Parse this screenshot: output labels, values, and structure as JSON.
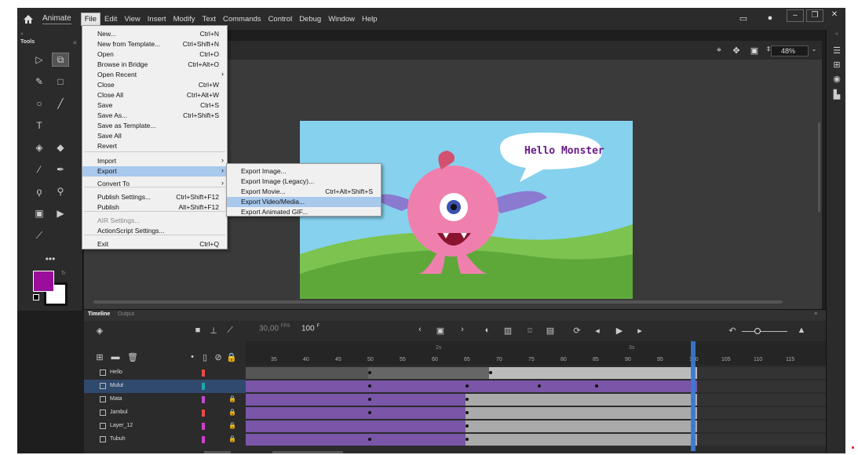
{
  "app": {
    "name": "Animate"
  },
  "menubar": [
    "File",
    "Edit",
    "View",
    "Insert",
    "Modify",
    "Text",
    "Commands",
    "Control",
    "Debug",
    "Window",
    "Help"
  ],
  "tools": {
    "title": "Tools"
  },
  "colors": {
    "fill": "#9b0d9b",
    "stroke": "#ffffff",
    "accent": "#3a7bd5",
    "selected_layer": "#304a6e"
  },
  "file_menu": [
    {
      "label": "New...",
      "shortcut": "Ctrl+N"
    },
    {
      "label": "New from Template...",
      "shortcut": "Ctrl+Shift+N"
    },
    {
      "label": "Open",
      "shortcut": "Ctrl+O"
    },
    {
      "label": "Browse in Bridge",
      "shortcut": "Ctrl+Alt+O"
    },
    {
      "label": "Open Recent",
      "shortcut": "",
      "submenu": true
    },
    {
      "label": "Close",
      "shortcut": "Ctrl+W"
    },
    {
      "label": "Close All",
      "shortcut": "Ctrl+Alt+W"
    },
    {
      "label": "Save",
      "shortcut": "Ctrl+S"
    },
    {
      "label": "Save As...",
      "shortcut": "Ctrl+Shift+S"
    },
    {
      "label": "Save as Template...",
      "shortcut": ""
    },
    {
      "label": "Save All",
      "shortcut": ""
    },
    {
      "label": "Revert",
      "shortcut": ""
    },
    {
      "label": "Import",
      "shortcut": "",
      "submenu": true
    },
    {
      "label": "Export",
      "shortcut": "",
      "submenu": true,
      "highlight": true
    },
    {
      "label": "Convert To",
      "shortcut": "",
      "submenu": true
    },
    {
      "label": "Publish Settings...",
      "shortcut": "Ctrl+Shift+F12"
    },
    {
      "label": "Publish",
      "shortcut": "Alt+Shift+F12"
    },
    {
      "label": "AIR Settings...",
      "shortcut": "",
      "disabled": true
    },
    {
      "label": "ActionScript Settings...",
      "shortcut": ""
    },
    {
      "label": "Exit",
      "shortcut": "Ctrl+Q"
    }
  ],
  "export_menu": [
    {
      "label": "Export Image...",
      "shortcut": ""
    },
    {
      "label": "Export Image (Legacy)...",
      "shortcut": ""
    },
    {
      "label": "Export Movie...",
      "shortcut": "Ctrl+Alt+Shift+S"
    },
    {
      "label": "Export Video/Media...",
      "shortcut": "",
      "highlight": true
    },
    {
      "label": "Export Animated GIF...",
      "shortcut": ""
    }
  ],
  "stage": {
    "zoom": "48%",
    "speech_text": "Hello Monster"
  },
  "timeline": {
    "tabs": [
      "Timeline",
      "Output"
    ],
    "fps": "30,00",
    "fps_unit": "FPS",
    "frame": "100",
    "frame_unit": "F",
    "frame_ticks": [
      "35",
      "40",
      "45",
      "50",
      "55",
      "60",
      "65",
      "70",
      "75",
      "80",
      "85",
      "90",
      "95",
      "100",
      "105",
      "110",
      "115"
    ],
    "time_marks": [
      "2s",
      "3s"
    ],
    "layers": [
      {
        "name": "Hello",
        "color": "#e84a4a",
        "locked": false
      },
      {
        "name": "Mulut",
        "color": "#1fa8a8",
        "locked": false,
        "selected": true
      },
      {
        "name": "Mata",
        "color": "#c04ad0",
        "locked": true
      },
      {
        "name": "Jambul",
        "color": "#e84a4a",
        "locked": true
      },
      {
        "name": "Layer_12",
        "color": "#d040d0",
        "locked": true
      },
      {
        "name": "Tubuh",
        "color": "#d040d0",
        "locked": true
      }
    ]
  }
}
